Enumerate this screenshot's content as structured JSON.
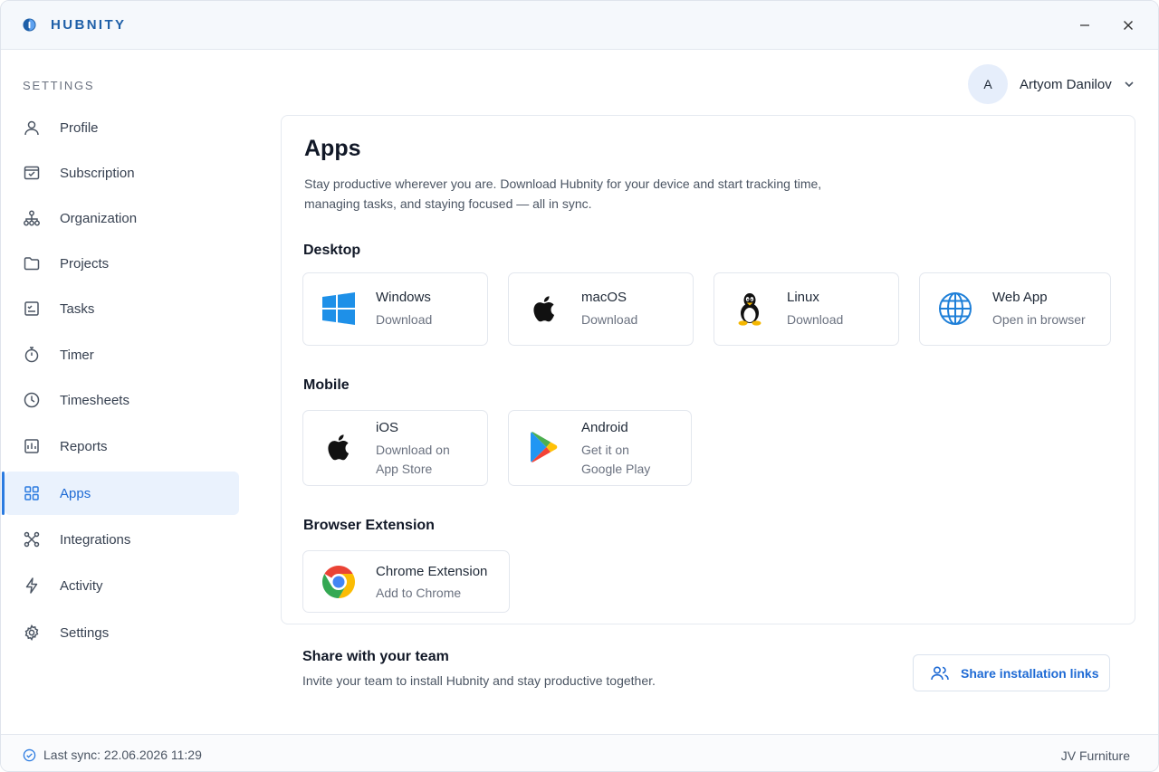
{
  "app": {
    "name": "HUBNITY",
    "brand_color": "#1e5fa8",
    "accent_color": "#2b7be0"
  },
  "window_controls": {
    "minimize_icon": "minimize-icon",
    "close_icon": "close-icon"
  },
  "sidebar": {
    "title": "SETTINGS",
    "items": [
      {
        "label": "Profile",
        "icon": "user-icon",
        "active": false
      },
      {
        "label": "Subscription",
        "icon": "subscription-icon",
        "active": false
      },
      {
        "label": "Organization",
        "icon": "org-chart-icon",
        "active": false
      },
      {
        "label": "Projects",
        "icon": "folder-icon",
        "active": false
      },
      {
        "label": "Tasks",
        "icon": "tasks-icon",
        "active": false
      },
      {
        "label": "Timer",
        "icon": "stopwatch-icon",
        "active": false
      },
      {
        "label": "Timesheets",
        "icon": "clock-icon",
        "active": false
      },
      {
        "label": "Reports",
        "icon": "chart-icon",
        "active": false
      },
      {
        "label": "Apps",
        "icon": "grid-icon",
        "active": true
      },
      {
        "label": "Integrations",
        "icon": "integrations-icon",
        "active": false
      },
      {
        "label": "Activity",
        "icon": "bolt-icon",
        "active": false
      },
      {
        "label": "Settings",
        "icon": "gear-icon",
        "active": false
      }
    ]
  },
  "user": {
    "initial": "A",
    "name": "Artyom Danilov"
  },
  "main": {
    "title": "Apps",
    "description": "Stay productive wherever you are. Download Hubnity for your device and start tracking time, managing tasks, and staying focused — all in sync.",
    "sections": {
      "desktop": {
        "title": "Desktop",
        "apps": [
          {
            "name": "Windows",
            "action": "Download",
            "icon": "windows-icon"
          },
          {
            "name": "macOS",
            "action": "Download",
            "icon": "apple-icon"
          },
          {
            "name": "Linux",
            "action": "Download",
            "icon": "linux-tux-icon"
          },
          {
            "name": "Web App",
            "action": "Open in browser",
            "icon": "globe-icon"
          }
        ]
      },
      "mobile": {
        "title": "Mobile",
        "apps": [
          {
            "name": "iOS",
            "action_line1": "Download on",
            "action_line2": "App Store",
            "icon": "apple-icon"
          },
          {
            "name": "Android",
            "action_line1": "Get it on",
            "action_line2": "Google Play",
            "icon": "google-play-icon"
          }
        ]
      },
      "browser": {
        "title": "Browser Extension",
        "apps": [
          {
            "name": "Chrome Extension",
            "action": "Add to Chrome",
            "icon": "chrome-icon"
          }
        ]
      }
    }
  },
  "share": {
    "title": "Share with your team",
    "description": "Invite your team to install Hubnity and stay productive together.",
    "button_label": "Share installation links",
    "button_icon": "users-icon"
  },
  "footer": {
    "sync_text": "Last sync: 22.06.2026 11:29",
    "workspace": "JV Furniture"
  }
}
